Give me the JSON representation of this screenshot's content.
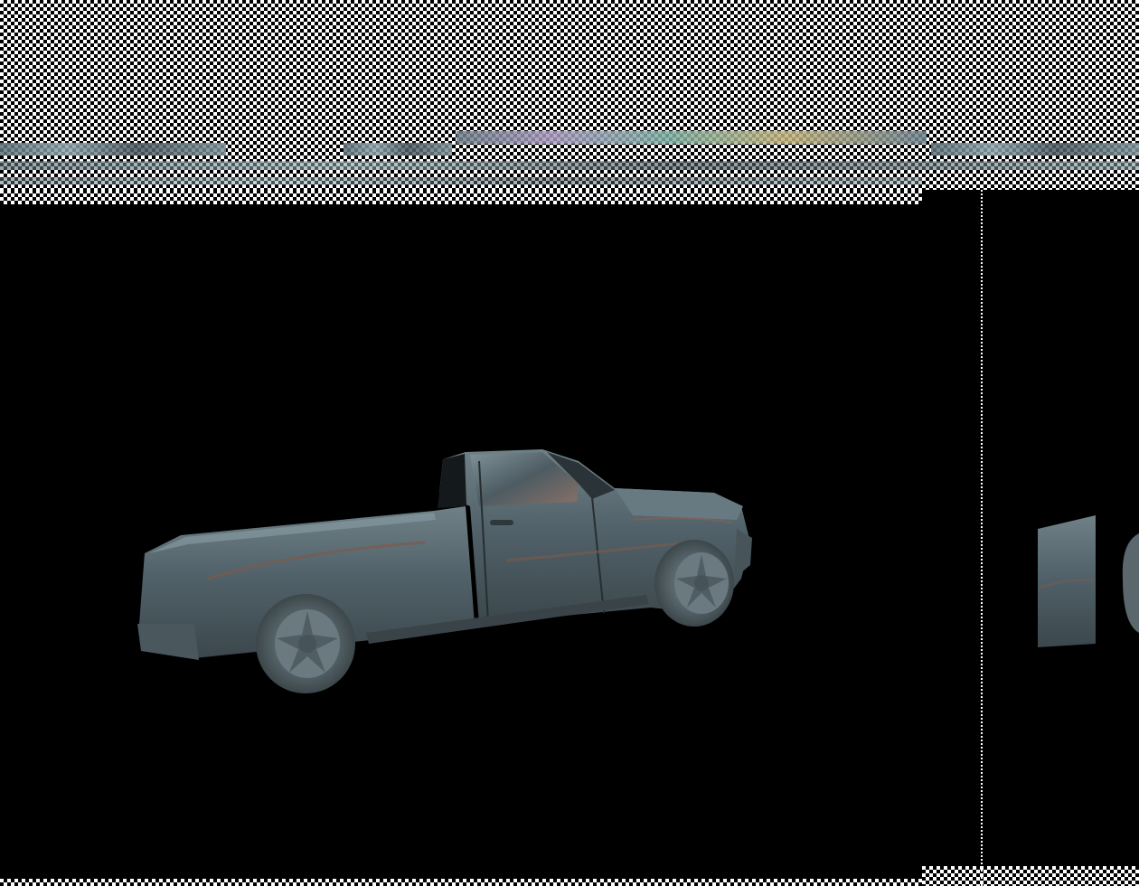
{
  "scene": {
    "background": "#000000",
    "body_color": "#56656b",
    "accent_color": "#7d5a4a",
    "wheel_color": "#6b7a80"
  }
}
